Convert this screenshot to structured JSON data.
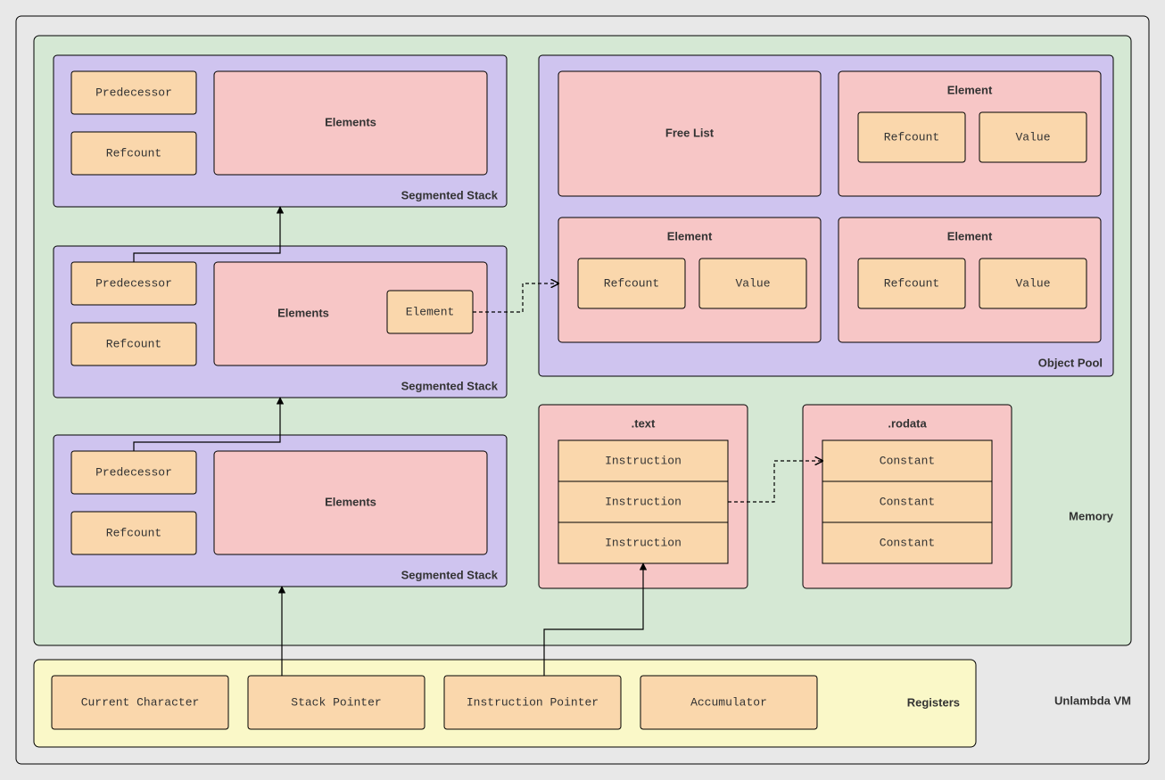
{
  "title": "Unlambda VM",
  "memory": {
    "label": "Memory",
    "segmented_stack_label": "Segmented Stack",
    "stack_fields": {
      "predecessor": "Predecessor",
      "refcount": "Refcount",
      "elements": "Elements",
      "element": "Element"
    },
    "object_pool": {
      "label": "Object Pool",
      "free_list": "Free List",
      "element_label": "Element",
      "refcount": "Refcount",
      "value": "Value"
    },
    "text_section": {
      "label": ".text",
      "rows": [
        "Instruction",
        "Instruction",
        "Instruction"
      ]
    },
    "rodata_section": {
      "label": ".rodata",
      "rows": [
        "Constant",
        "Constant",
        "Constant"
      ]
    }
  },
  "registers": {
    "label": "Registers",
    "items": [
      "Current Character",
      "Stack Pointer",
      "Instruction Pointer",
      "Accumulator"
    ]
  }
}
